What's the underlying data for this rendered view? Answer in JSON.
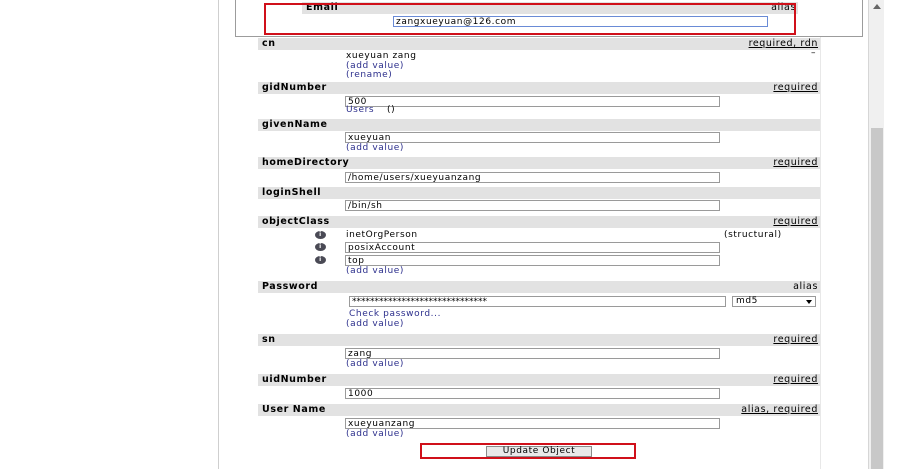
{
  "email": {
    "label": "Email",
    "right": "alias",
    "value": "zangxueyuan@126.com"
  },
  "cn": {
    "label": "cn",
    "right": "required, rdn",
    "value": "xueyuan zang",
    "add": "(add value)",
    "rename": "(rename)"
  },
  "gidNumber": {
    "label": "gidNumber",
    "right": "required",
    "value": "500",
    "group_link": "Users",
    "group_paren": "()"
  },
  "givenName": {
    "label": "givenName",
    "value": "xueyuan",
    "add": "(add value)"
  },
  "homeDirectory": {
    "label": "homeDirectory",
    "right": "required",
    "value": "/home/users/xueyuanzang"
  },
  "loginShell": {
    "label": "loginShell",
    "value": "/bin/sh"
  },
  "objectClass": {
    "label": "objectClass",
    "right": "required",
    "values": [
      "inetOrgPerson",
      "posixAccount",
      "top"
    ],
    "structural": "(structural)",
    "add": "(add value)"
  },
  "password": {
    "label": "Password",
    "right": "alias",
    "value": "******************************",
    "hash": "md5",
    "check": "Check password...",
    "add": "(add value)"
  },
  "sn": {
    "label": "sn",
    "right": "required",
    "value": "zang",
    "add": "(add value)"
  },
  "uidNumber": {
    "label": "uidNumber",
    "right": "required",
    "value": "1000"
  },
  "userName": {
    "label": "User Name",
    "right": "alias, required",
    "value": "xueyuanzang",
    "add": "(add value)"
  },
  "update_button": "Update Object",
  "colors": {
    "header": "#e2e2e2",
    "link": "#2c2f8c",
    "highlight": "#d0101a"
  }
}
